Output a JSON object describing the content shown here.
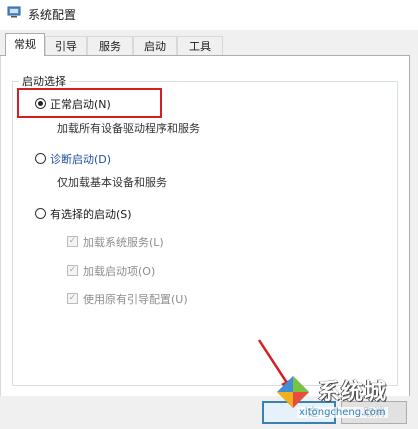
{
  "window": {
    "title": "系统配置"
  },
  "tabs": [
    {
      "label": "常规",
      "active": true
    },
    {
      "label": "引导",
      "active": false
    },
    {
      "label": "服务",
      "active": false
    },
    {
      "label": "启动",
      "active": false
    },
    {
      "label": "工具",
      "active": false
    }
  ],
  "startup_selection": {
    "group_title": "启动选择",
    "options": [
      {
        "label": "正常启动(N)",
        "description": "加载所有设备驱动程序和服务",
        "selected": true
      },
      {
        "label": "诊断启动(D)",
        "description": "仅加载基本设备和服务",
        "selected": false
      },
      {
        "label": "有选择的启动(S)",
        "selected": false
      }
    ],
    "selective_items": [
      {
        "label": "加载系统服务(L)",
        "checked": true,
        "enabled": false
      },
      {
        "label": "加载启动项(O)",
        "checked": true,
        "enabled": false
      },
      {
        "label": "使用原有引导配置(U)",
        "checked": true,
        "enabled": false
      }
    ]
  },
  "buttons": {
    "ok_partial": "定",
    "cancel_partial": "取消"
  },
  "watermark": {
    "name": "系统城",
    "url": "xitongcheng.com"
  },
  "colors": {
    "highlight": "#d31f1f",
    "link_blue": "#1f4ea1",
    "focus_border": "#3c7fb1"
  },
  "icons": {
    "title": "system-config-icon",
    "annotation": "red-arrow-icon"
  }
}
